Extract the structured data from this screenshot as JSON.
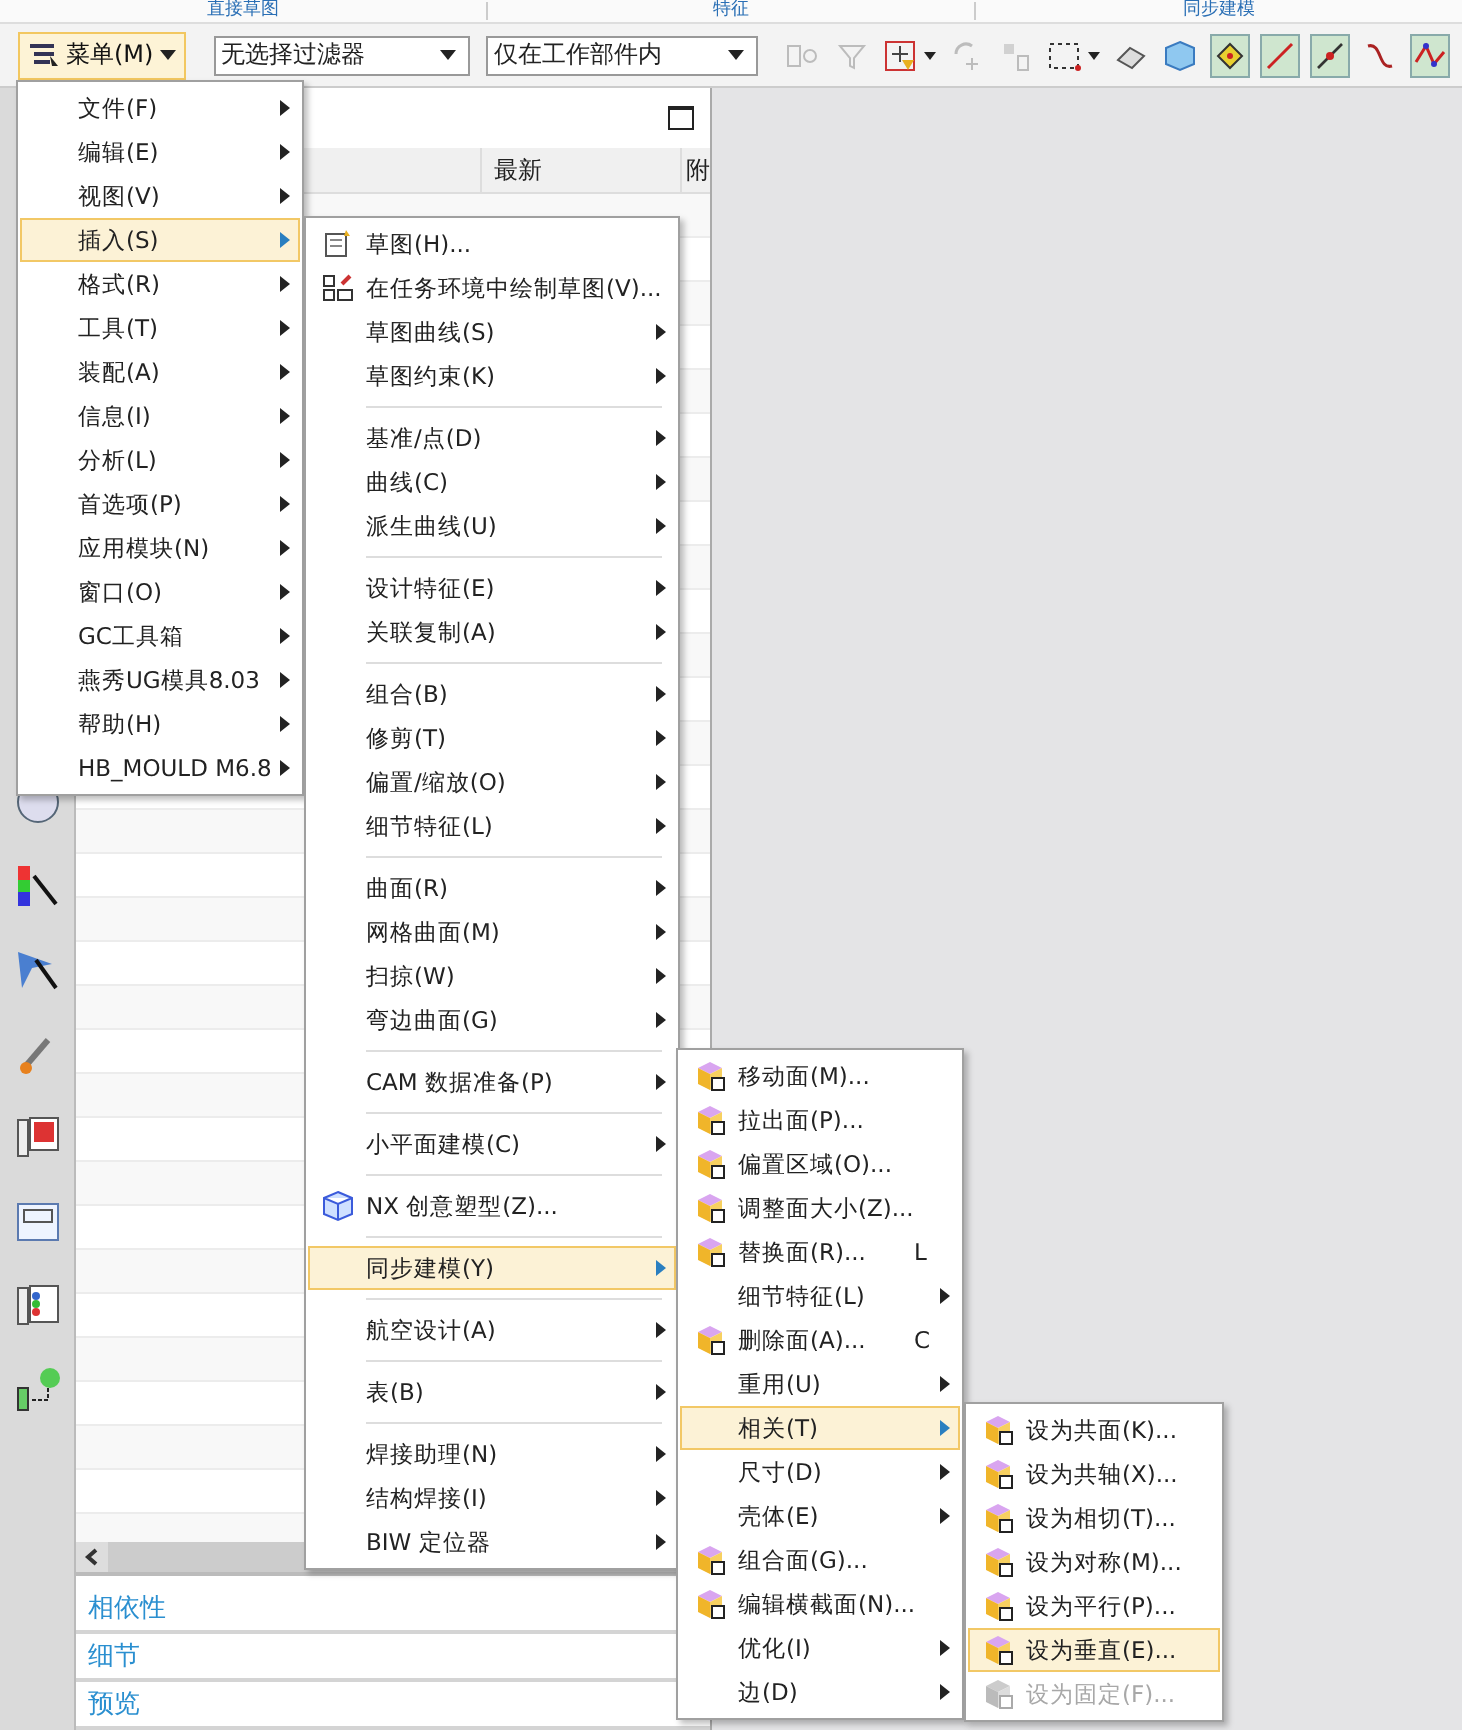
{
  "ribbon_groups": [
    "直接草图",
    "特征",
    "同步建模"
  ],
  "toolbar": {
    "menu_button": "菜单(M)",
    "filters": [
      {
        "value": "无选择过滤器"
      },
      {
        "value": "仅在工作部件内"
      }
    ],
    "tools": [
      {
        "kind": "mirror",
        "disabled": true,
        "on": false,
        "dropdown": false
      },
      {
        "kind": "filter",
        "disabled": true,
        "on": false,
        "dropdown": false
      },
      {
        "kind": "snap",
        "disabled": false,
        "on": false,
        "dropdown": true
      },
      {
        "kind": "rotate",
        "disabled": true,
        "on": false,
        "dropdown": false
      },
      {
        "kind": "move",
        "disabled": true,
        "on": false,
        "dropdown": false
      },
      {
        "kind": "select-box",
        "disabled": false,
        "on": false,
        "dropdown": true
      },
      {
        "kind": "eraser",
        "disabled": false,
        "on": false,
        "dropdown": false
      },
      {
        "kind": "cube",
        "disabled": false,
        "on": false,
        "dropdown": false
      },
      {
        "kind": "points",
        "disabled": false,
        "on": true,
        "dropdown": false
      },
      {
        "kind": "line",
        "disabled": false,
        "on": true,
        "dropdown": false
      },
      {
        "kind": "line-point",
        "disabled": false,
        "on": true,
        "dropdown": false
      },
      {
        "kind": "curve",
        "disabled": false,
        "on": false,
        "dropdown": false
      },
      {
        "kind": "spline",
        "disabled": false,
        "on": true,
        "dropdown": false
      }
    ]
  },
  "navigator": {
    "columns": [
      {
        "label": "最新"
      },
      {
        "label": "附"
      }
    ],
    "sections": [
      "相依性",
      "细节",
      "预览"
    ]
  },
  "menus": [
    {
      "items": [
        {
          "kind": "plain",
          "label": "文件(F)",
          "submenu": true,
          "selected": false
        },
        {
          "kind": "plain",
          "label": "编辑(E)",
          "submenu": true,
          "selected": false
        },
        {
          "kind": "plain",
          "label": "视图(V)",
          "submenu": true,
          "selected": false
        },
        {
          "kind": "plain",
          "label": "插入(S)",
          "submenu": true,
          "selected": true
        },
        {
          "kind": "plain",
          "label": "格式(R)",
          "submenu": true,
          "selected": false
        },
        {
          "kind": "plain",
          "label": "工具(T)",
          "submenu": true,
          "selected": false
        },
        {
          "kind": "plain",
          "label": "装配(A)",
          "submenu": true,
          "selected": false
        },
        {
          "kind": "plain",
          "label": "信息(I)",
          "submenu": true,
          "selected": false
        },
        {
          "kind": "plain",
          "label": "分析(L)",
          "submenu": true,
          "selected": false
        },
        {
          "kind": "plain",
          "label": "首选项(P)",
          "submenu": true,
          "selected": false
        },
        {
          "kind": "plain",
          "label": "应用模块(N)",
          "submenu": true,
          "selected": false
        },
        {
          "kind": "plain",
          "label": "窗口(O)",
          "submenu": true,
          "selected": false
        },
        {
          "kind": "plain",
          "label": "GC工具箱",
          "submenu": true,
          "selected": false
        },
        {
          "kind": "plain",
          "label": "燕秀UG模具8.03",
          "submenu": true,
          "selected": false
        },
        {
          "kind": "plain",
          "label": "帮助(H)",
          "submenu": true,
          "selected": false
        },
        {
          "kind": "plain",
          "label": "HB_MOULD M6.8",
          "submenu": true,
          "selected": false
        }
      ]
    },
    {
      "items": [
        {
          "kind": "icon",
          "label": "草图(H)...",
          "submenu": false,
          "selected": false
        },
        {
          "kind": "icon",
          "label": "在任务环境中绘制草图(V)...",
          "submenu": false,
          "selected": false
        },
        {
          "kind": "plain",
          "label": "草图曲线(S)",
          "submenu": true,
          "selected": false
        },
        {
          "kind": "plain",
          "label": "草图约束(K)",
          "submenu": true,
          "selected": false
        },
        {
          "kind": "separator"
        },
        {
          "kind": "plain",
          "label": "基准/点(D)",
          "submenu": true,
          "selected": false
        },
        {
          "kind": "plain",
          "label": "曲线(C)",
          "submenu": true,
          "selected": false
        },
        {
          "kind": "plain",
          "label": "派生曲线(U)",
          "submenu": true,
          "selected": false
        },
        {
          "kind": "separator"
        },
        {
          "kind": "plain",
          "label": "设计特征(E)",
          "submenu": true,
          "selected": false
        },
        {
          "kind": "plain",
          "label": "关联复制(A)",
          "submenu": true,
          "selected": false
        },
        {
          "kind": "separator"
        },
        {
          "kind": "plain",
          "label": "组合(B)",
          "submenu": true,
          "selected": false
        },
        {
          "kind": "plain",
          "label": "修剪(T)",
          "submenu": true,
          "selected": false
        },
        {
          "kind": "plain",
          "label": "偏置/缩放(O)",
          "submenu": true,
          "selected": false
        },
        {
          "kind": "plain",
          "label": "细节特征(L)",
          "submenu": true,
          "selected": false
        },
        {
          "kind": "separator"
        },
        {
          "kind": "plain",
          "label": "曲面(R)",
          "submenu": true,
          "selected": false
        },
        {
          "kind": "plain",
          "label": "网格曲面(M)",
          "submenu": true,
          "selected": false
        },
        {
          "kind": "plain",
          "label": "扫掠(W)",
          "submenu": true,
          "selected": false
        },
        {
          "kind": "plain",
          "label": "弯边曲面(G)",
          "submenu": true,
          "selected": false
        },
        {
          "kind": "separator"
        },
        {
          "kind": "plain",
          "label": "CAM 数据准备(P)",
          "submenu": true,
          "selected": false
        },
        {
          "kind": "separator"
        },
        {
          "kind": "plain",
          "label": "小平面建模(C)",
          "submenu": true,
          "selected": false
        },
        {
          "kind": "separator"
        },
        {
          "kind": "icon",
          "label": "NX 创意塑型(Z)...",
          "submenu": false,
          "selected": false
        },
        {
          "kind": "separator"
        },
        {
          "kind": "plain",
          "label": "同步建模(Y)",
          "submenu": true,
          "selected": true
        },
        {
          "kind": "separator"
        },
        {
          "kind": "plain",
          "label": "航空设计(A)",
          "submenu": true,
          "selected": false
        },
        {
          "kind": "separator"
        },
        {
          "kind": "plain",
          "label": "表(B)",
          "submenu": true,
          "selected": false
        },
        {
          "kind": "separator"
        },
        {
          "kind": "plain",
          "label": "焊接助理(N)",
          "submenu": true,
          "selected": false
        },
        {
          "kind": "plain",
          "label": "结构焊接(I)",
          "submenu": true,
          "selected": false
        },
        {
          "kind": "plain",
          "label": "BIW 定位器",
          "submenu": true,
          "selected": false
        }
      ]
    },
    {
      "items": [
        {
          "kind": "icon",
          "label": "移动面(M)...",
          "submenu": false,
          "selected": false
        },
        {
          "kind": "icon",
          "label": "拉出面(P)...",
          "submenu": false,
          "selected": false
        },
        {
          "kind": "icon",
          "label": "偏置区域(O)...",
          "submenu": false,
          "selected": false
        },
        {
          "kind": "icon",
          "label": "调整面大小(Z)...",
          "submenu": false,
          "selected": false
        },
        {
          "kind": "icon",
          "label": "替换面(R)...",
          "shortcut": "L",
          "submenu": false,
          "selected": false
        },
        {
          "kind": "plain",
          "label": "细节特征(L)",
          "submenu": true,
          "selected": false
        },
        {
          "kind": "icon",
          "label": "删除面(A)...",
          "shortcut": "C",
          "submenu": false,
          "selected": false
        },
        {
          "kind": "plain",
          "label": "重用(U)",
          "submenu": true,
          "selected": false
        },
        {
          "kind": "plain",
          "label": "相关(T)",
          "submenu": true,
          "selected": true
        },
        {
          "kind": "plain",
          "label": "尺寸(D)",
          "submenu": true,
          "selected": false
        },
        {
          "kind": "plain",
          "label": "壳体(E)",
          "submenu": true,
          "selected": false
        },
        {
          "kind": "icon",
          "label": "组合面(G)...",
          "submenu": false,
          "selected": false
        },
        {
          "kind": "icon",
          "label": "编辑横截面(N)...",
          "submenu": false,
          "selected": false
        },
        {
          "kind": "plain",
          "label": "优化(I)",
          "submenu": true,
          "selected": false
        },
        {
          "kind": "plain",
          "label": "边(D)",
          "submenu": true,
          "selected": false
        }
      ]
    },
    {
      "items": [
        {
          "kind": "icon",
          "label": "设为共面(K)...",
          "submenu": false,
          "selected": false,
          "disabled": false
        },
        {
          "kind": "icon",
          "label": "设为共轴(X)...",
          "submenu": false,
          "selected": false,
          "disabled": false
        },
        {
          "kind": "icon",
          "label": "设为相切(T)...",
          "submenu": false,
          "selected": false,
          "disabled": false
        },
        {
          "kind": "icon",
          "label": "设为对称(M)...",
          "submenu": false,
          "selected": false,
          "disabled": false
        },
        {
          "kind": "icon",
          "label": "设为平行(P)...",
          "submenu": false,
          "selected": false,
          "disabled": false
        },
        {
          "kind": "icon",
          "label": "设为垂直(E)...",
          "submenu": false,
          "selected": true,
          "disabled": false
        },
        {
          "kind": "icon",
          "label": "设为固定(F)...",
          "submenu": false,
          "selected": false,
          "disabled": true
        }
      ]
    }
  ]
}
